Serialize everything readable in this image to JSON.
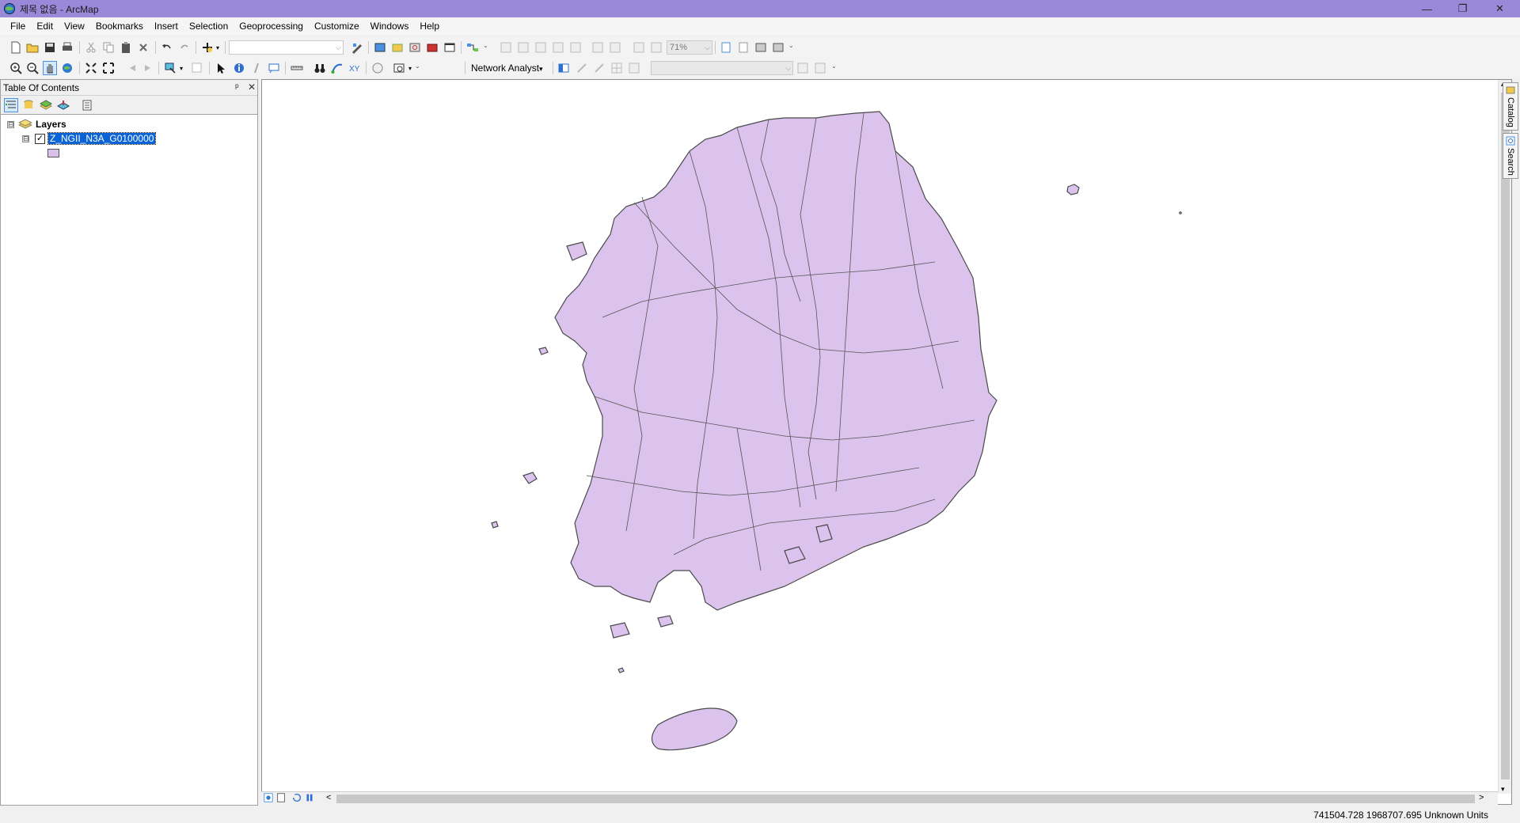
{
  "window": {
    "title": "제목 없음 - ArcMap",
    "accent": "#9a88d8"
  },
  "menu": [
    "File",
    "Edit",
    "View",
    "Bookmarks",
    "Insert",
    "Selection",
    "Geoprocessing",
    "Customize",
    "Windows",
    "Help"
  ],
  "toolbar": {
    "zoom_level": "71%",
    "network_analyst_label": "Network Analyst",
    "network_analyst_arrow": "▾"
  },
  "toc": {
    "title": "Table Of Contents",
    "pin": "ᵖ",
    "close": "✕",
    "root_expander": "⊟",
    "root_label": "Layers",
    "layer_expander": "⊟",
    "layer_check": "✓",
    "layer_name": "Z_NGII_N3A_G0100000",
    "symbol_color": "#d9c1ea"
  },
  "map": {
    "fill": "#dcc3ee",
    "stroke": "#4a4a4a"
  },
  "side_tabs": [
    "Catalog",
    "Search"
  ],
  "status": {
    "coordinates": "741504.728  1968707.695 Unknown Units"
  },
  "scroll": {
    "left": "<",
    "right": ">",
    "up": "▴",
    "down": "▾"
  }
}
